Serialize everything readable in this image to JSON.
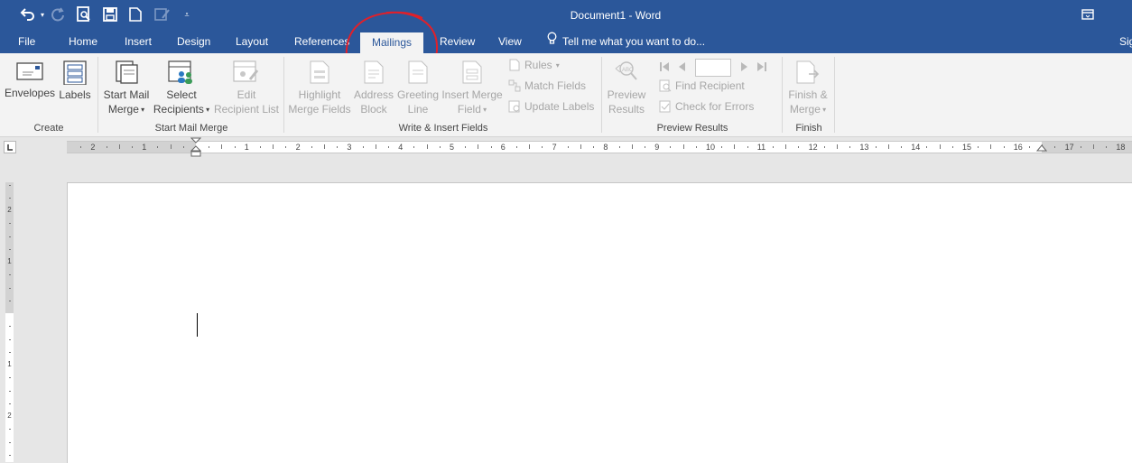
{
  "window": {
    "title": "Document1 - Word",
    "account_label": "Sig"
  },
  "qat": {
    "icons": [
      "undo-icon",
      "redo-icon",
      "print-preview-icon",
      "save-icon",
      "new-document-icon",
      "touch-mode-icon",
      "customize-qat-icon"
    ]
  },
  "tabs": [
    {
      "label": "File"
    },
    {
      "label": "Home"
    },
    {
      "label": "Insert"
    },
    {
      "label": "Design"
    },
    {
      "label": "Layout"
    },
    {
      "label": "References"
    },
    {
      "label": "Mailings"
    },
    {
      "label": "Review"
    },
    {
      "label": "View"
    }
  ],
  "tell_me": {
    "placeholder": "Tell me what you want to do..."
  },
  "ribbon": {
    "create": {
      "label": "Create",
      "envelopes": "Envelopes",
      "labels": "Labels"
    },
    "start_mail_merge": {
      "label": "Start Mail Merge",
      "start_mail_merge_line1": "Start Mail",
      "start_mail_merge_line2": "Merge",
      "select_recipients_line1": "Select",
      "select_recipients_line2": "Recipients",
      "edit_recipient_line1": "Edit",
      "edit_recipient_line2": "Recipient List"
    },
    "write_insert": {
      "label": "Write & Insert Fields",
      "highlight_line1": "Highlight",
      "highlight_line2": "Merge Fields",
      "address_line1": "Address",
      "address_line2": "Block",
      "greeting_line1": "Greeting",
      "greeting_line2": "Line",
      "insert_merge_line1": "Insert Merge",
      "insert_merge_line2": "Field",
      "rules": "Rules",
      "match_fields": "Match Fields",
      "update_labels": "Update Labels"
    },
    "preview": {
      "label": "Preview Results",
      "preview_line1": "Preview",
      "preview_line2": "Results",
      "find_recipient": "Find Recipient",
      "check_errors": "Check for Errors",
      "record_value": ""
    },
    "finish": {
      "label": "Finish",
      "finish_line1": "Finish &",
      "finish_line2": "Merge"
    }
  },
  "ruler": {
    "labels": [
      "2",
      "1",
      "1",
      "2",
      "3",
      "4",
      "5",
      "6",
      "7",
      "8",
      "9",
      "10",
      "11",
      "12",
      "13",
      "14",
      "15",
      "16",
      "17",
      "18"
    ],
    "vertical_labels": [
      "2",
      "1",
      "1",
      "2"
    ]
  },
  "colors": {
    "accent": "#2b579a",
    "ribbon_bg": "#f3f3f3",
    "disabled_text": "#a6a6a6",
    "annotation": "#e0202a"
  }
}
